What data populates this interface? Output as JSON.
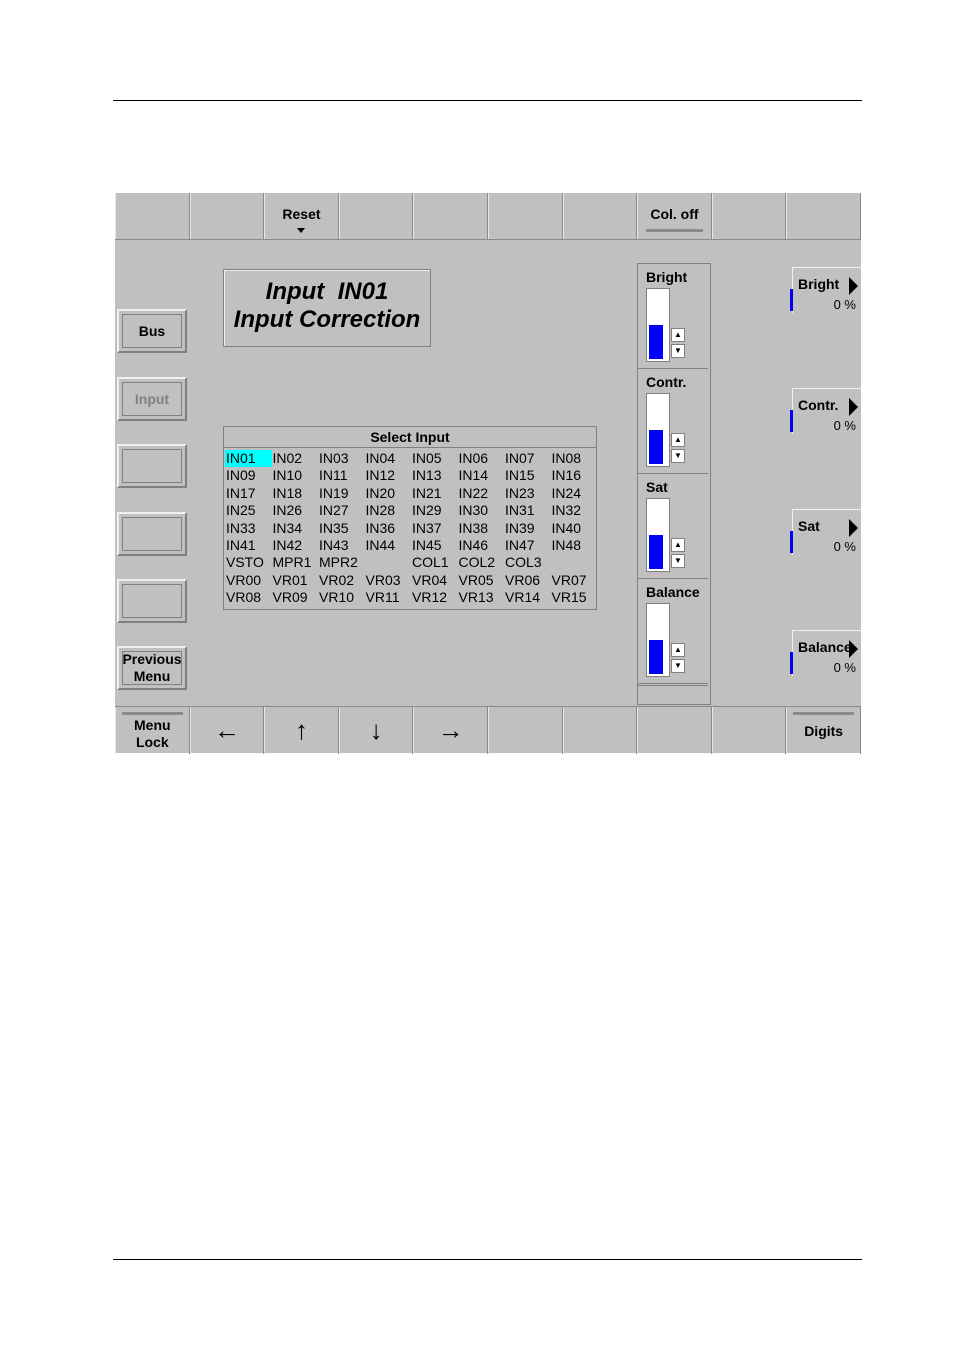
{
  "top_bar": [
    "",
    "",
    "Reset",
    "",
    "",
    "",
    "",
    "Col. off",
    "",
    ""
  ],
  "title": {
    "line1": "Input  IN01",
    "line2": "Input Correction"
  },
  "side_buttons": {
    "bus": "Bus",
    "input": "Input",
    "b3": "",
    "b4": "",
    "b5": "",
    "previous": "Previous Menu"
  },
  "select_input": {
    "header": "Select Input",
    "selected": "IN01",
    "rows": [
      [
        "IN01",
        "IN02",
        "IN03",
        "IN04",
        "IN05",
        "IN06",
        "IN07",
        "IN08"
      ],
      [
        "IN09",
        "IN10",
        "IN11",
        "IN12",
        "IN13",
        "IN14",
        "IN15",
        "IN16"
      ],
      [
        "IN17",
        "IN18",
        "IN19",
        "IN20",
        "IN21",
        "IN22",
        "IN23",
        "IN24"
      ],
      [
        "IN25",
        "IN26",
        "IN27",
        "IN28",
        "IN29",
        "IN30",
        "IN31",
        "IN32"
      ],
      [
        "IN33",
        "IN34",
        "IN35",
        "IN36",
        "IN37",
        "IN38",
        "IN39",
        "IN40"
      ],
      [
        "IN41",
        "IN42",
        "IN43",
        "IN44",
        "IN45",
        "IN46",
        "IN47",
        "IN48"
      ],
      [
        "VSTO",
        "MPR1",
        "MPR2",
        "",
        "COL1",
        "COL2",
        "COL3",
        ""
      ],
      [
        "VR00",
        "VR01",
        "VR02",
        "VR03",
        "VR04",
        "VR05",
        "VR06",
        "VR07"
      ],
      [
        "VR08",
        "VR09",
        "VR10",
        "VR11",
        "VR12",
        "VR13",
        "VR14",
        "VR15"
      ]
    ]
  },
  "sliders": [
    {
      "label": "Bright",
      "level_pct": 50
    },
    {
      "label": "Contr.",
      "level_pct": 50
    },
    {
      "label": "Sat",
      "level_pct": 50
    },
    {
      "label": "Balance",
      "level_pct": 50
    }
  ],
  "right_buttons": [
    {
      "label": "Bright",
      "value": "0 %"
    },
    {
      "label": "Contr.",
      "value": "0 %"
    },
    {
      "label": "Sat",
      "value": "0 %"
    },
    {
      "label": "Balance",
      "value": "0 %"
    }
  ],
  "bottom_bar": {
    "menu_lock": "Menu Lock",
    "left": "←",
    "up": "↑",
    "down": "↓",
    "right": "→",
    "digits": "Digits"
  }
}
